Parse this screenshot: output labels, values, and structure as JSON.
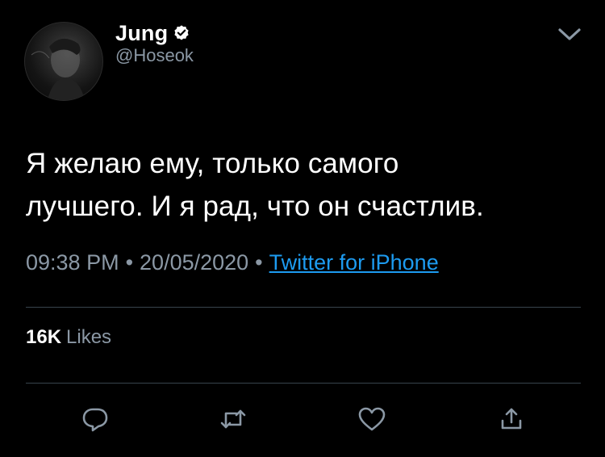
{
  "user": {
    "display_name": "Jung",
    "handle": "@Hoseok",
    "verified": true
  },
  "tweet": {
    "text_line1": "Я желаю ему, только самого",
    "text_line2": "лучшего. И я рад, что он счастлив.",
    "time": "09:38 PM",
    "date": "20/05/2020",
    "separator": "•",
    "source": "Twitter for iPhone"
  },
  "stats": {
    "likes_count": "16K",
    "likes_label": "Likes"
  },
  "icons": {
    "more": "chevron-down-icon",
    "verified": "verified-badge-icon",
    "reply": "reply-icon",
    "retweet": "retweet-icon",
    "like": "heart-icon",
    "share": "share-icon"
  },
  "colors": {
    "background": "#000000",
    "primary_text": "#ffffff",
    "secondary_text": "#8b98a5",
    "link": "#1d9bf0",
    "divider": "#38444d"
  }
}
